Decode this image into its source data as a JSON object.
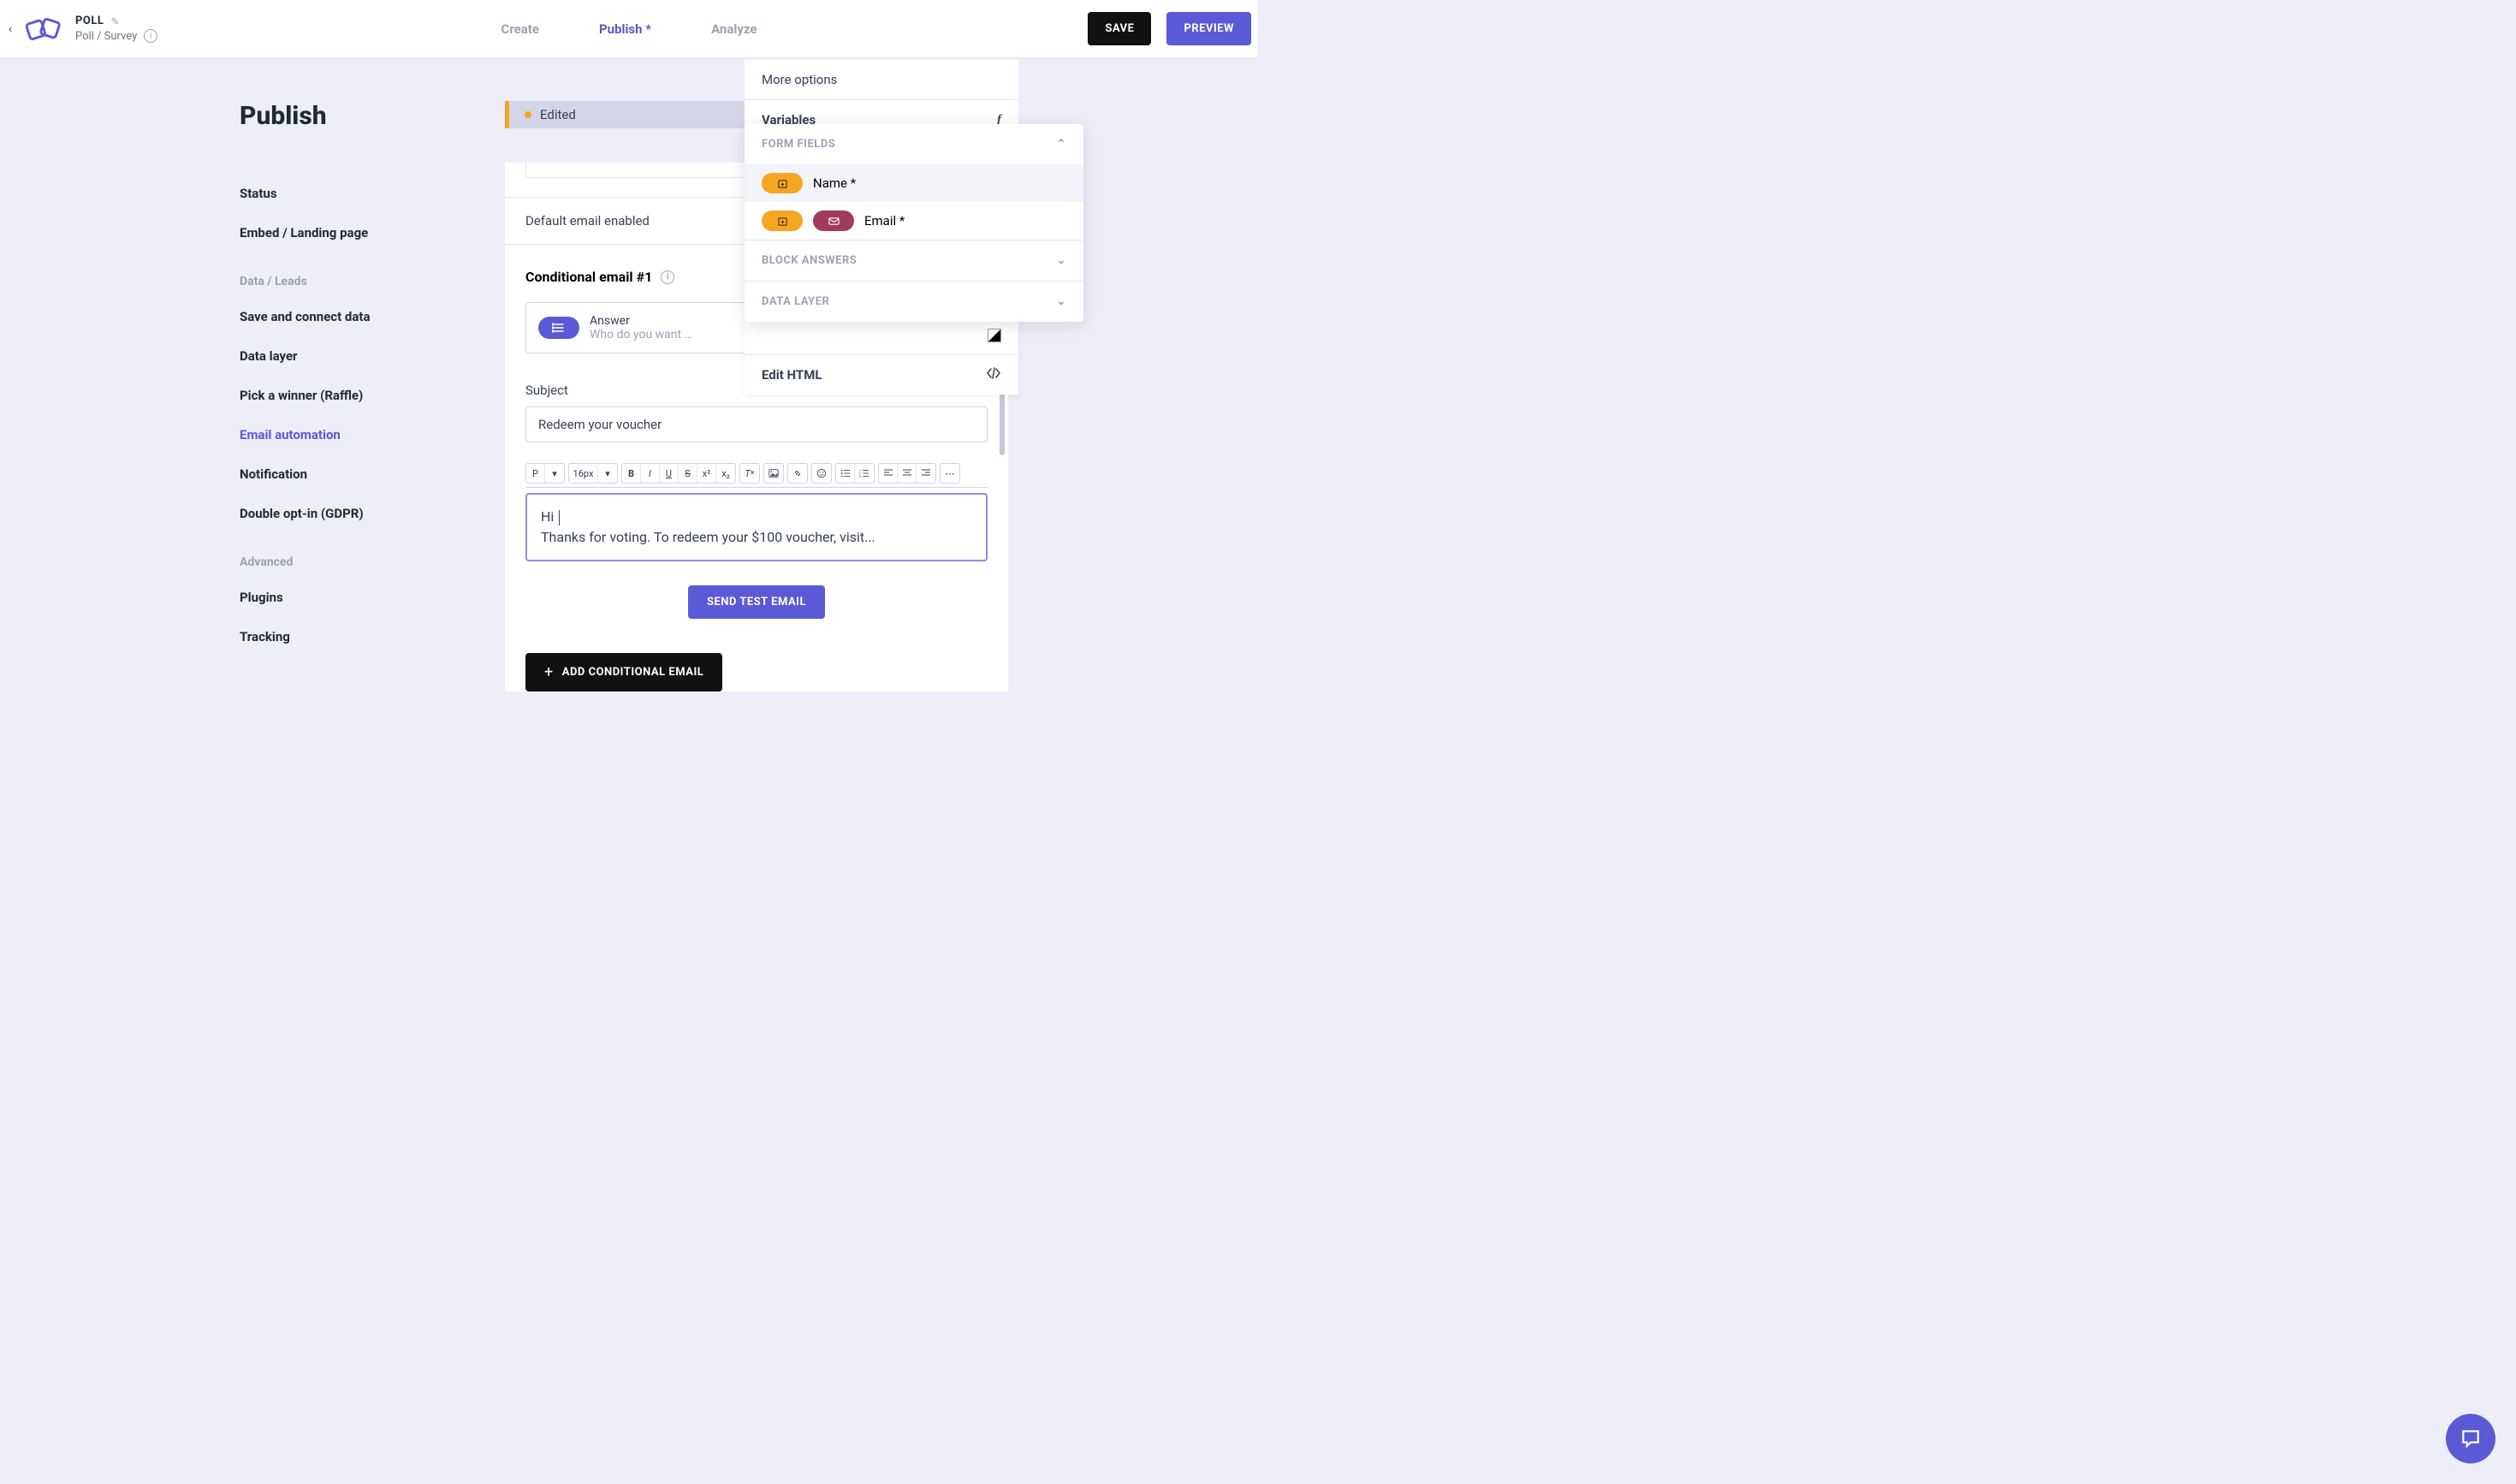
{
  "header": {
    "title": "POLL",
    "subtitle": "Poll / Survey",
    "nav": {
      "create": "Create",
      "publish": "Publish *",
      "analyze": "Analyze"
    },
    "save": "SAVE",
    "preview": "PREVIEW"
  },
  "sidebar": {
    "heading": "Publish",
    "items": {
      "status": "Status",
      "embed": "Embed / Landing page",
      "section_data": "Data / Leads",
      "save_connect": "Save and connect data",
      "data_layer": "Data layer",
      "raffle": "Pick a winner (Raffle)",
      "email_auto": "Email automation",
      "notification": "Notification",
      "gdpr": "Double opt-in (GDPR)",
      "section_adv": "Advanced",
      "plugins": "Plugins",
      "tracking": "Tracking"
    }
  },
  "content": {
    "edited": "Edited",
    "default_email": "Default email enabled",
    "cond_heading": "Conditional email #1",
    "answer_label": "Answer",
    "answer_placeholder": "Who do you want …",
    "subject_label": "Subject",
    "subject_value": "Redeem your voucher",
    "body_line1": "Hi ",
    "body_line2": "Thanks for voting. To redeem your $100 voucher, visit...",
    "send_test": "SEND TEST EMAIL",
    "add_cond": "ADD CONDITIONAL EMAIL",
    "toolbar": {
      "para": "P",
      "size": "16px"
    }
  },
  "right_panel": {
    "more_options": "More options",
    "variables": "Variables",
    "edit_html": "Edit HTML"
  },
  "var_popover": {
    "form_fields": "FORM FIELDS",
    "name": "Name *",
    "email": "Email *",
    "block_answers": "BLOCK ANSWERS",
    "data_layer": "DATA LAYER"
  }
}
